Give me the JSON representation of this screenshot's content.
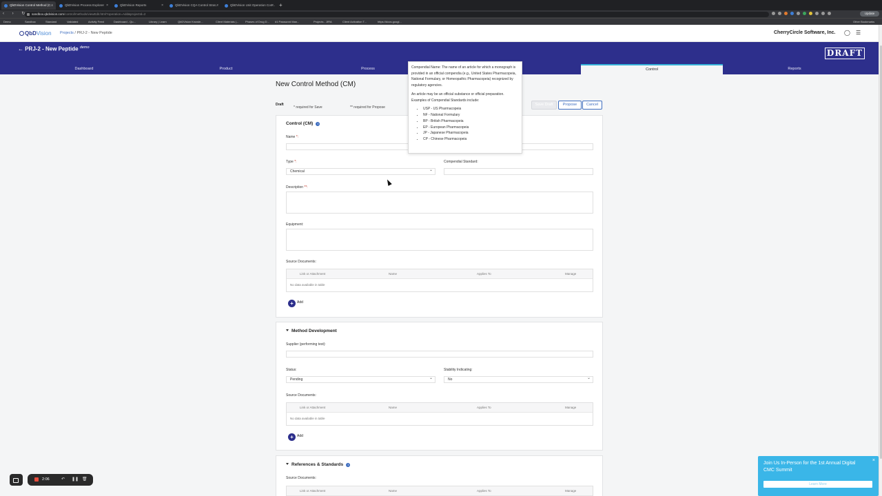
{
  "browser": {
    "tabs": [
      {
        "label": "QbDVision Control Method (C...",
        "active": true
      },
      {
        "label": "QbDVision Process Explorer",
        "active": false
      },
      {
        "label": "QbDVision Reports",
        "active": false
      },
      {
        "label": "QbDVision CQA Control Strat...",
        "active": false
      },
      {
        "label": "QbDVision Unit Operation Con...",
        "active": false
      }
    ],
    "tab_close": "×",
    "new_tab": "+",
    "nav_glyphs": "‹ › ↻",
    "url_host": "sandbox.qbdvision.com",
    "url_path": "/control/methods/viewEdit.html?operation=Add&projectId=2",
    "update_label": "Update",
    "bookmarks": [
      "Demo",
      "Sandbox",
      "Standard",
      "Validated",
      "Activity Feed",
      "Dashboard - Qu...",
      "Library | Learn",
      "QbDVision Knowle...",
      "Client Materials |...",
      "Phases of Drug D...",
      "#1 Password Man...",
      "Projects - JIRA",
      "Client Activation T...",
      "https://docs.googl..."
    ],
    "other_bookmarks": "Other Bookmarks"
  },
  "header": {
    "logo_main": "QbD",
    "logo_light": "Vision",
    "breadcrumb_link": "Projects",
    "breadcrumb_sep": " / ",
    "breadcrumb_current": "PRJ-2 - New Peptide",
    "company": "CherryCircle Software, Inc.",
    "chat_icon": "◯",
    "menu_icon": "☰"
  },
  "band": {
    "back_title": "← PRJ-2 - New Peptide",
    "back_tag": "demo",
    "draft_stamp": "DRAFT",
    "tabs": [
      {
        "label": "Dashboard",
        "active": false
      },
      {
        "label": "Product",
        "active": false
      },
      {
        "label": "Process",
        "active": false
      },
      {
        "label": "Control",
        "active": true
      },
      {
        "label": "Reports",
        "active": false
      }
    ]
  },
  "page": {
    "title": "New Control Method (CM)",
    "status": "Draft",
    "req_save": "* required for Save",
    "req_propose": "** required for Propose",
    "buttons": {
      "save_draft": "Save Draft",
      "propose": "Propose",
      "cancel": "Cancel"
    }
  },
  "control": {
    "title": "Control (CM)",
    "info": "i",
    "name_label": "Name ",
    "name_star": "*:",
    "type_label": "Type ",
    "type_star": "*:",
    "type_value": "Chemical",
    "compendial_label": "Compendial Standard:",
    "description_label": "Description ",
    "description_star": "**:",
    "equipment_label": "Equipment:",
    "source_docs_label": "Source Documents:",
    "table_headers": [
      "Link or Attachment",
      "Name",
      "Applies To",
      "Manage"
    ],
    "empty_text": "No data available in table",
    "add_label": "Add"
  },
  "method_dev": {
    "title": "Method Development",
    "supplier_label": "Supplier (performing test):",
    "status_label": "Status:",
    "status_value": "Pending",
    "stability_label": "Stability Indicating:",
    "stability_value": "No",
    "source_docs_label": "Source Documents:",
    "table_headers": [
      "Link or Attachment",
      "Name",
      "Applies To",
      "Manage"
    ],
    "empty_text": "No data available in table",
    "add_label": "Add"
  },
  "references": {
    "title": "References & Standards",
    "info": "i",
    "source_docs_label": "Source Documents:",
    "table_headers": [
      "Link or Attachment",
      "Name",
      "Applies To",
      "Manage"
    ]
  },
  "tooltip": {
    "para1": "Compendial Name: The name of an article for which a monograph is provided in an official compendia (e.g., United States Pharmacopeia, National Formulary, or Homeopathic Pharmacopeia) recognized by regulatory agencies.",
    "para2": "An article may be an official substance or official preparation. Examples of Compendial Standards include:",
    "items": [
      "USP - US Pharmacopeia",
      "NF - National Formulary",
      "BP - British Pharmacopeia",
      "EP - European Pharmacopeia",
      "JP - Japanese Pharmacopeia",
      "CP - Chinese Pharmacopeia"
    ]
  },
  "recorder": {
    "time": "2:06",
    "pause": "❚❚",
    "undo": "↶",
    "trash": "🗑"
  },
  "banner": {
    "message": "Join Us In-Person for the 1st Annual Digital CMC Summit",
    "cta": "Learn More",
    "close": "×"
  }
}
